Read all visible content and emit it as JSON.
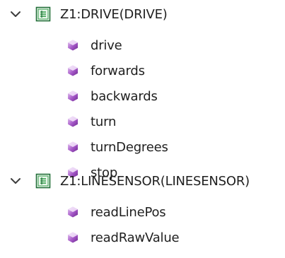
{
  "tree": {
    "nodes": [
      {
        "label": "Z1:DRIVE(DRIVE)",
        "expanded": true,
        "icon": "component-icon",
        "children": [
          {
            "label": "drive",
            "icon": "method-icon"
          },
          {
            "label": "forwards",
            "icon": "method-icon"
          },
          {
            "label": "backwards",
            "icon": "method-icon"
          },
          {
            "label": "turn",
            "icon": "method-icon"
          },
          {
            "label": "turnDegrees",
            "icon": "method-icon"
          },
          {
            "label": "stop",
            "icon": "method-icon"
          }
        ]
      },
      {
        "label": "Z1:LINESENSOR(LINESENSOR)",
        "expanded": true,
        "icon": "component-icon",
        "children": [
          {
            "label": "readLinePos",
            "icon": "method-icon"
          },
          {
            "label": "readRawValue",
            "icon": "method-icon"
          }
        ]
      }
    ]
  },
  "colors": {
    "method_icon_light": "#d9b3ea",
    "method_icon_mid": "#a558c8",
    "method_icon_dark": "#6e2a8f",
    "component_icon_green": "#2f9b46",
    "component_icon_dark": "#1e6d35",
    "chevron": "#3c3c3c"
  }
}
